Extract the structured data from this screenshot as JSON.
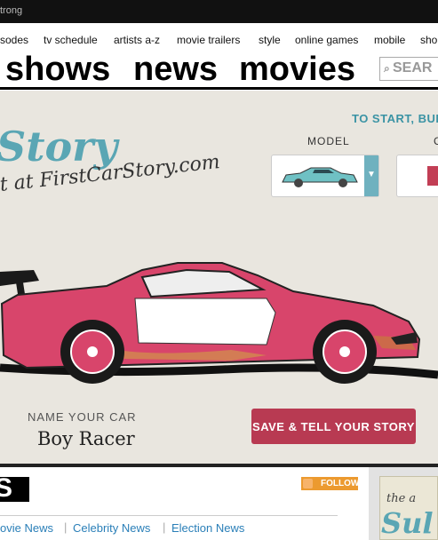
{
  "top_strip": {
    "text": "trong"
  },
  "nav": {
    "items": [
      "sodes",
      "tv schedule",
      "artists a-z",
      "movie trailers",
      "style",
      "online games",
      "mobile",
      "sho"
    ]
  },
  "header": {
    "items": [
      "shows",
      "news",
      "movies"
    ],
    "search_label": "SEAR"
  },
  "promo": {
    "title": "Story",
    "url": "t at FirstCarStory.com",
    "instruction": "TO START, BUILD &",
    "model_label": "MODEL",
    "color_label": "C",
    "name_label": "NAME YOUR CAR",
    "car_name": "Boy Racer",
    "save_button": "SAVE & TELL YOUR STORY",
    "accent_color": "#b83a52",
    "brand_color": "#5aa6b4"
  },
  "bottom": {
    "section_title": "S",
    "follow_label": "FOLLOW",
    "links": [
      "ovie News",
      "Celebrity News",
      "Election News"
    ],
    "ad_text": "the a",
    "ad_title": "Sul"
  }
}
